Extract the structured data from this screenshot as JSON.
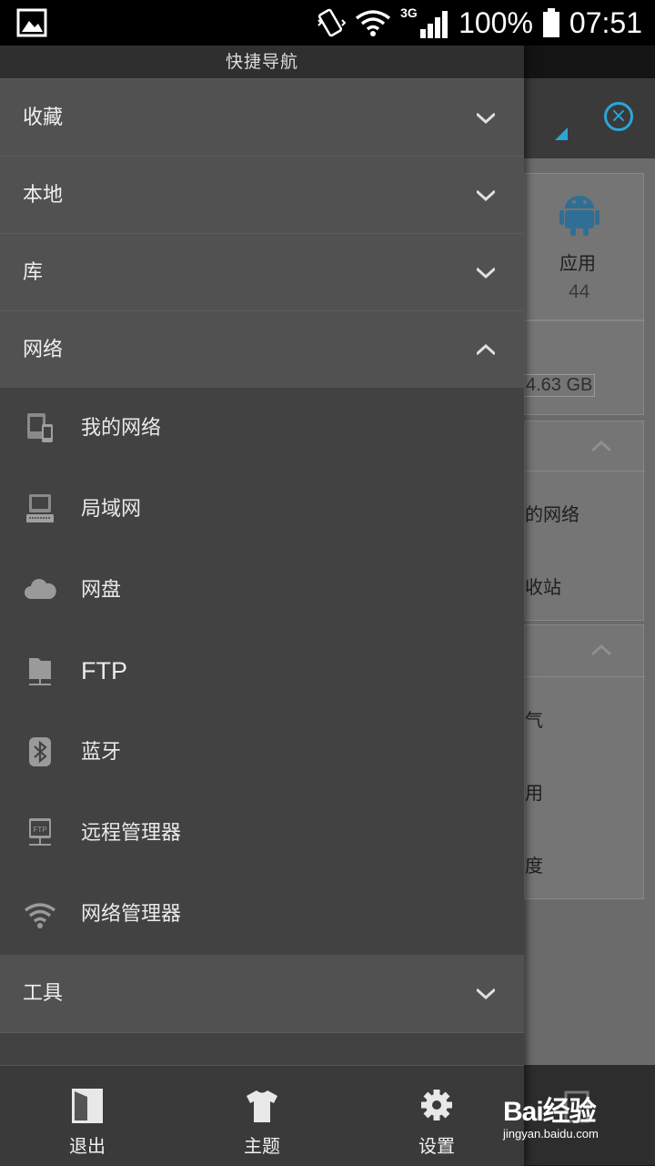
{
  "status_bar": {
    "network": "3G",
    "battery": "100%",
    "time": "07:51"
  },
  "background": {
    "app_card": {
      "label": "应用",
      "count": "44"
    },
    "storage": "4.63 GB",
    "partial_items": [
      "的网络",
      "收站",
      "气",
      "用",
      "度"
    ]
  },
  "drawer": {
    "title": "快捷导航",
    "sections": [
      {
        "label": "收藏",
        "expanded": false
      },
      {
        "label": "本地",
        "expanded": false
      },
      {
        "label": "库",
        "expanded": false
      },
      {
        "label": "网络",
        "expanded": true
      },
      {
        "label": "工具",
        "expanded": false
      }
    ],
    "network_items": [
      {
        "label": "我的网络",
        "icon": "devices-icon"
      },
      {
        "label": "局域网",
        "icon": "computer-icon"
      },
      {
        "label": "网盘",
        "icon": "cloud-icon"
      },
      {
        "label": "FTP",
        "icon": "ftp-server-icon"
      },
      {
        "label": "蓝牙",
        "icon": "bluetooth-icon"
      },
      {
        "label": "远程管理器",
        "icon": "remote-ftp-icon"
      },
      {
        "label": "网络管理器",
        "icon": "wifi-manager-icon"
      }
    ]
  },
  "bottom_bar": {
    "exit": "退出",
    "theme": "主题",
    "settings": "设置"
  },
  "watermark": {
    "brand": "Bai经验",
    "url": "jingyan.baidu.com"
  },
  "colors": {
    "accent": "#2aa6d8",
    "drawer_bg": "#424242",
    "section_bg": "#515151",
    "android_green": "#3a7fa6"
  }
}
